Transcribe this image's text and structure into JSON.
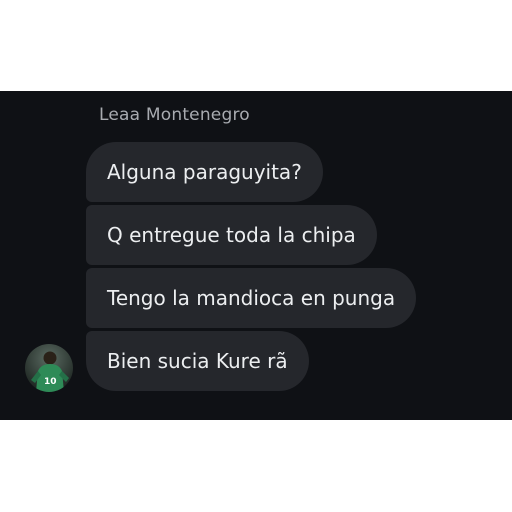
{
  "conversation": {
    "sender_name": "Leaa Montenegro",
    "messages": [
      {
        "text": "Alguna paraguyita?"
      },
      {
        "text": "Q entregue toda la chipa"
      },
      {
        "text": "Tengo la mandioca en punga"
      },
      {
        "text": "Bien sucia Kure rã"
      }
    ]
  },
  "avatar": {
    "jersey_number": "10",
    "jersey_color": "#2e8b57"
  },
  "colors": {
    "panel_background": "#0f1115",
    "bubble_background": "#25272c",
    "message_text": "#eceef0",
    "sender_name": "#a8abb0"
  }
}
